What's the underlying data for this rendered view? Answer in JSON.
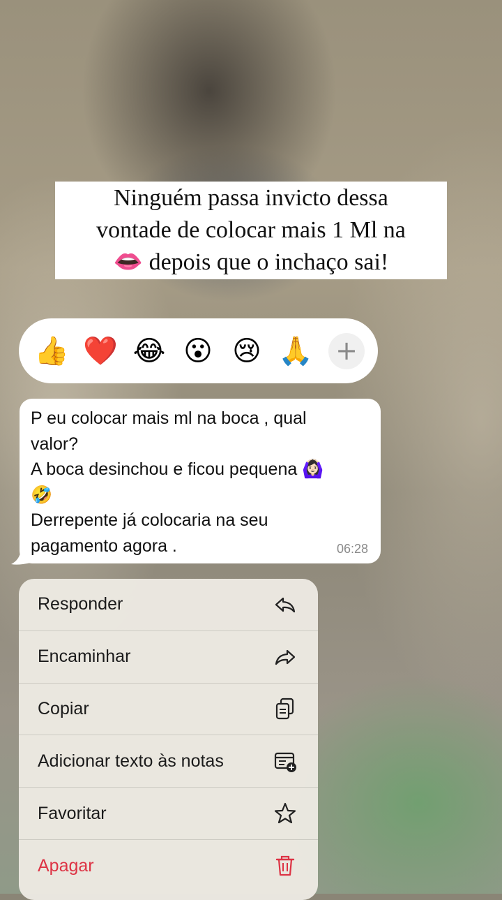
{
  "overlay_title": {
    "lines": [
      "Ninguém passa invicto dessa",
      "vontade de colocar mais 1 Ml na",
      "👄 depois que o inchaço sai!"
    ]
  },
  "reactions": {
    "items": [
      {
        "emoji": "👍",
        "name": "thumbs-up"
      },
      {
        "emoji": "❤️",
        "name": "red-heart"
      },
      {
        "emoji": "😂",
        "name": "tears-of-joy"
      },
      {
        "emoji": "😮",
        "name": "surprised"
      },
      {
        "emoji": "😢",
        "name": "crying"
      },
      {
        "emoji": "🙏",
        "name": "folded-hands"
      }
    ],
    "more_label": "+"
  },
  "message": {
    "lines": [
      "P eu colocar mais ml na boca , qual",
      "valor?",
      "A boca desinchou e ficou pequena 🙆🏻‍♀️",
      "🤣",
      "Derrepente já colocaria na seu",
      "pagamento agora ."
    ],
    "time": "06:28"
  },
  "context_menu": {
    "items": [
      {
        "label": "Responder",
        "icon": "reply-icon"
      },
      {
        "label": "Encaminhar",
        "icon": "forward-icon"
      },
      {
        "label": "Copiar",
        "icon": "copy-icon"
      },
      {
        "label": "Adicionar texto às notas",
        "icon": "add-note-icon"
      },
      {
        "label": "Favoritar",
        "icon": "star-icon"
      },
      {
        "label": "Apagar",
        "icon": "trash-icon"
      }
    ],
    "danger_color": "#dd3344"
  }
}
